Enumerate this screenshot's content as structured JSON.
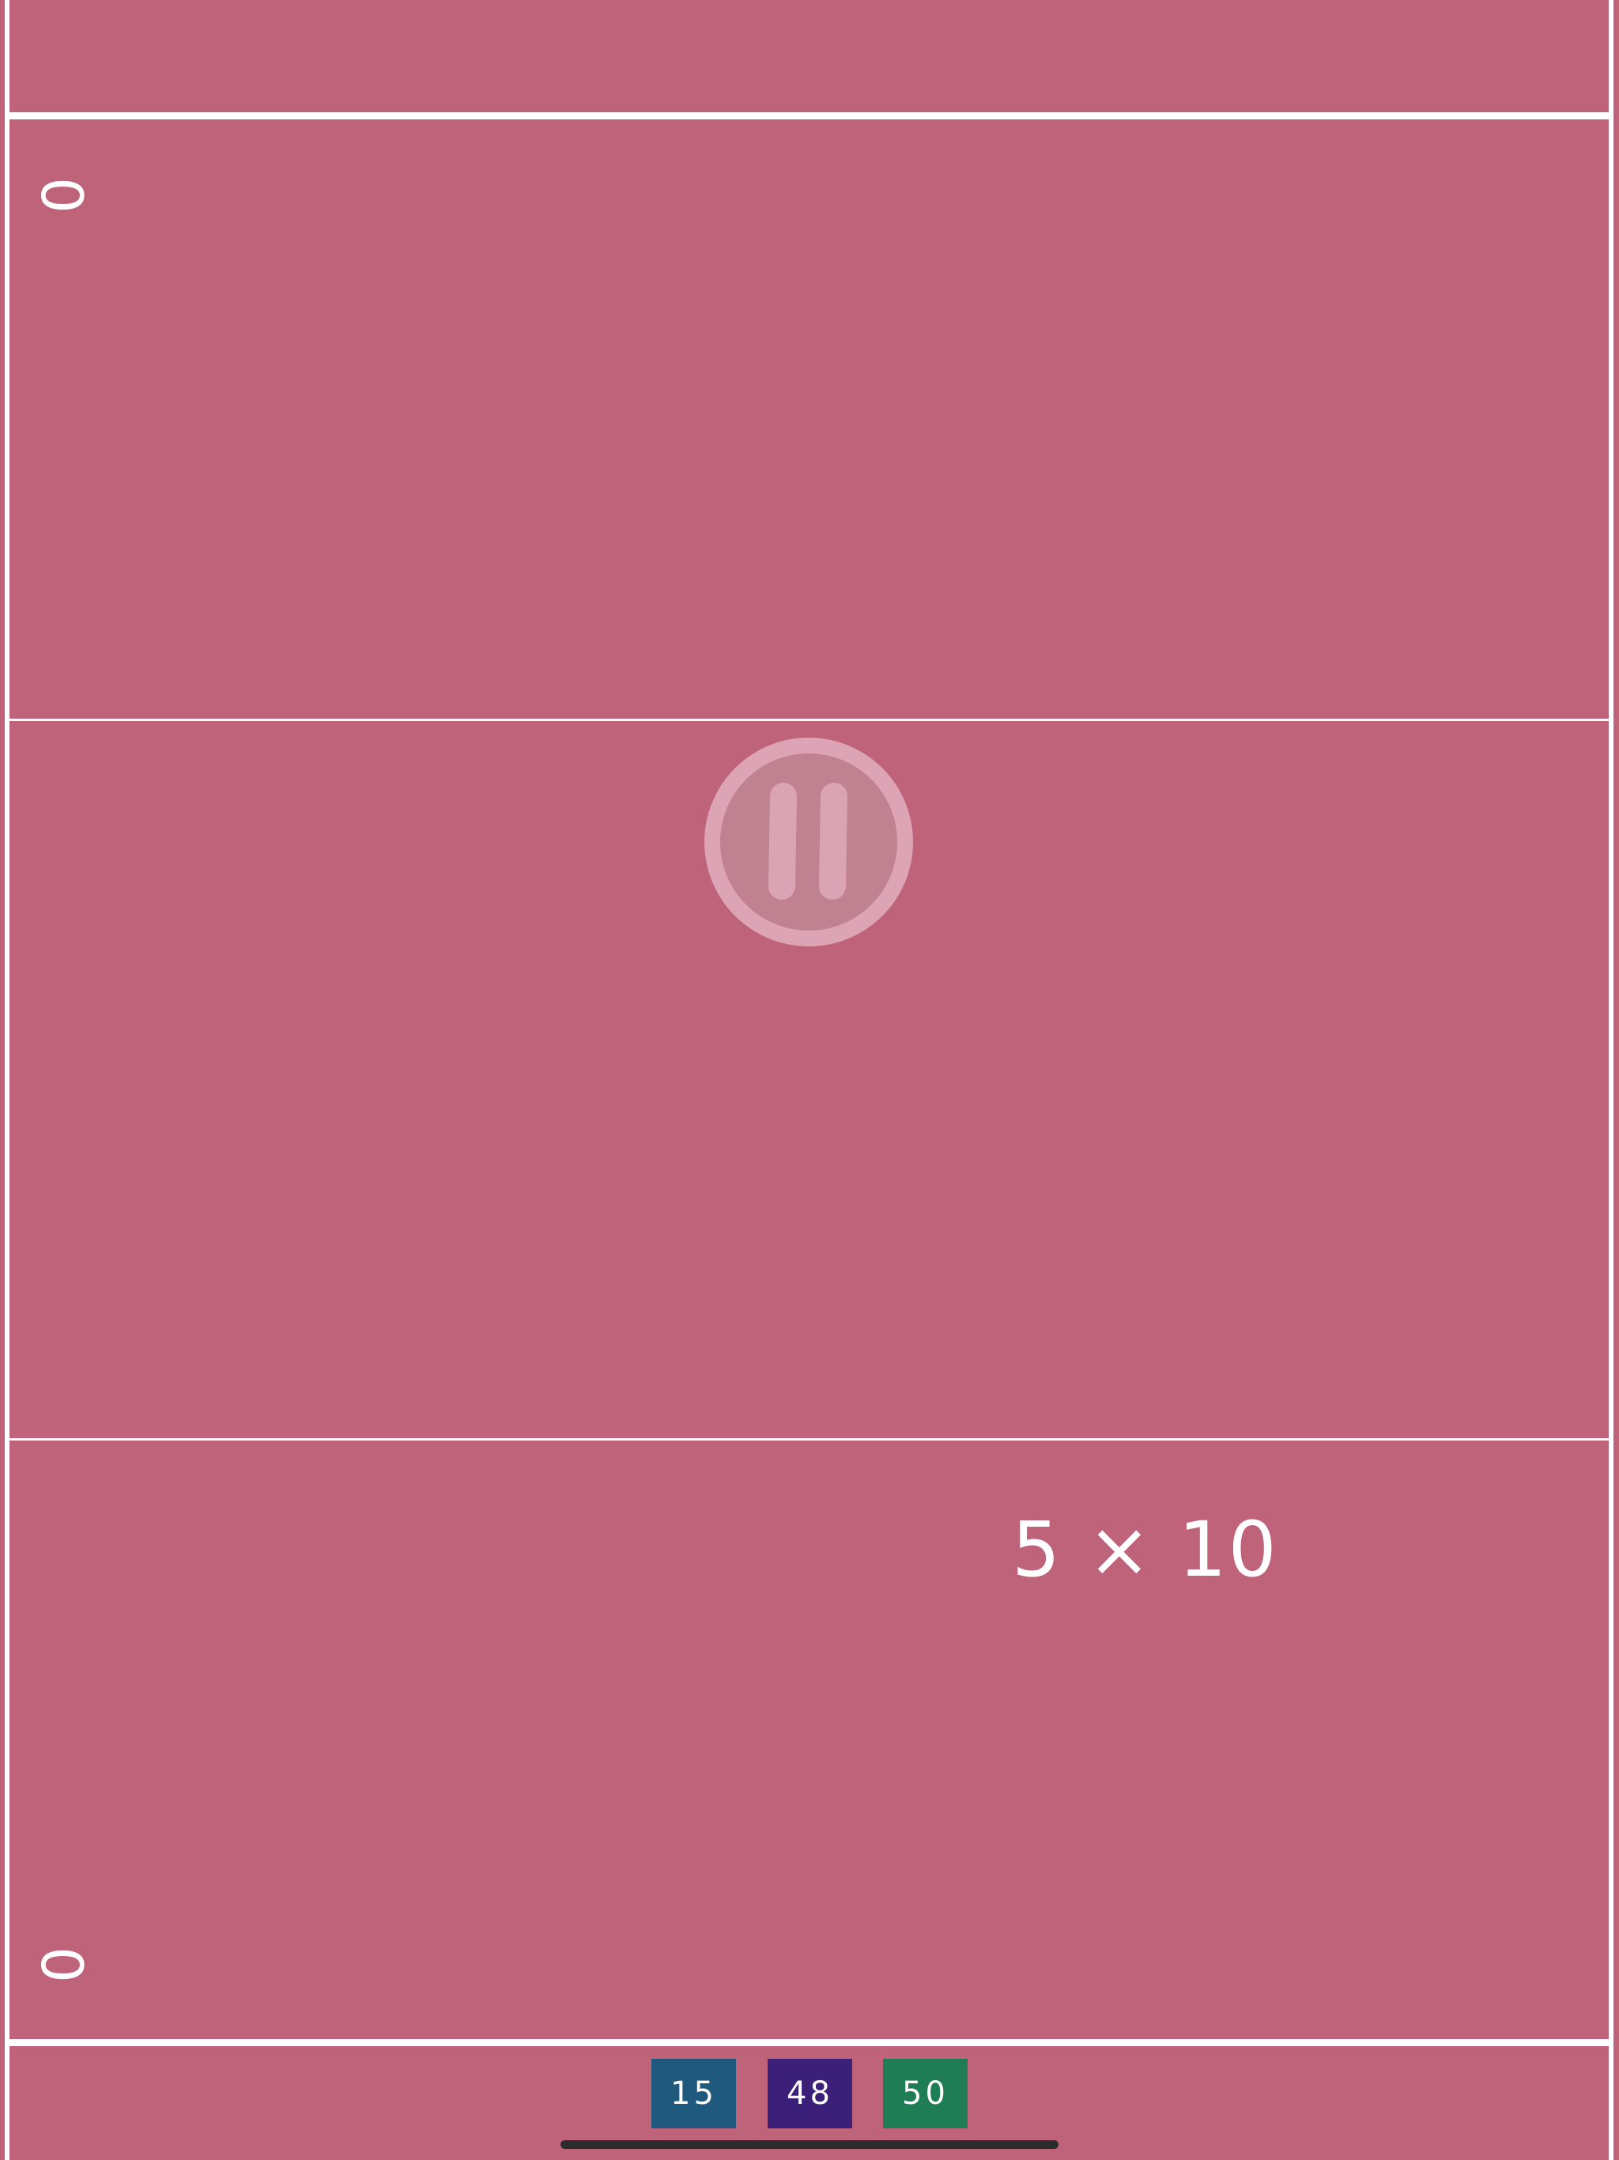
{
  "scores": {
    "top": "0",
    "bottom": "0"
  },
  "problem": {
    "text": "5 × 10"
  },
  "choices": [
    {
      "label": "15",
      "color": "#1f5a7e"
    },
    {
      "label": "48",
      "color": "#3b1f78"
    },
    {
      "label": "50",
      "color": "#1f7d55"
    }
  ],
  "colors": {
    "background": "#bf637b",
    "lines": "#ffffff"
  },
  "icons": {
    "pause": "pause-icon"
  }
}
